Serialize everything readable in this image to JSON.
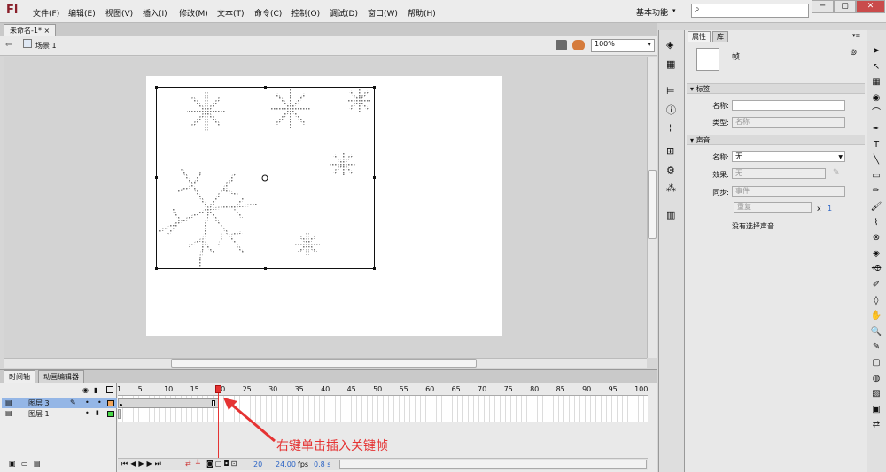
{
  "app": {
    "logo": "Fl"
  },
  "menu": [
    "文件(F)",
    "编辑(E)",
    "视图(V)",
    "插入(I)",
    "修改(M)",
    "文本(T)",
    "命令(C)",
    "控制(O)",
    "调试(D)",
    "窗口(W)",
    "帮助(H)"
  ],
  "workspace": {
    "label": "基本功能",
    "chevron": "▾"
  },
  "window_controls": {
    "minimize": "─",
    "restore": "▢",
    "close": "✕"
  },
  "document": {
    "tab": "未命名-1*",
    "close": "×"
  },
  "scene": {
    "label": "场景 1",
    "zoom": "100%"
  },
  "timeline": {
    "tabs": [
      "时间轴",
      "动画编辑器"
    ],
    "ruler": [
      "1",
      "5",
      "10",
      "15",
      "20",
      "25",
      "30",
      "35",
      "40",
      "45",
      "50",
      "55",
      "60",
      "65",
      "70",
      "75",
      "80",
      "85",
      "90",
      "95",
      "100"
    ],
    "layers": [
      {
        "name": "图层 3",
        "selected": true,
        "color": "#f2a55a"
      },
      {
        "name": "图层 1",
        "selected": false,
        "color": "#48d848"
      }
    ],
    "status": {
      "frame": "20",
      "fps": "24.00",
      "fps_unit": "fps",
      "time": "0.8 s"
    },
    "playhead_frame": 20
  },
  "annotation": "右键单击插入关键帧",
  "properties": {
    "tabs": [
      "属性",
      "库"
    ],
    "type_label": "帧",
    "sections": {
      "label": "标签",
      "sound": "声音"
    },
    "fields": {
      "name_label": "名称:",
      "type_label": "类型:",
      "type_value": "名称",
      "sound_name_label": "名称:",
      "sound_name_value": "无",
      "effect_label": "效果:",
      "effect_value": "无",
      "sync_label": "同步:",
      "sync_value": "事件",
      "repeat_value": "重复",
      "repeat_x": "x",
      "repeat_count": "1",
      "no_sound": "没有选择声音"
    }
  },
  "tools": [
    "➤",
    "↖",
    "▦",
    "◉",
    "⌒",
    "✒",
    "T",
    "╲",
    "▭",
    "✏",
    "🖌",
    "⌇",
    "⊗",
    "◈",
    "⬲",
    "✐",
    "◊",
    "✋",
    "🔍",
    "✎",
    "▢",
    "◍",
    "▨",
    "▣",
    "⇄"
  ],
  "colors": {
    "accent": "#8a1f2a",
    "playhead": "#e53333",
    "selection": "#94b6e6"
  }
}
